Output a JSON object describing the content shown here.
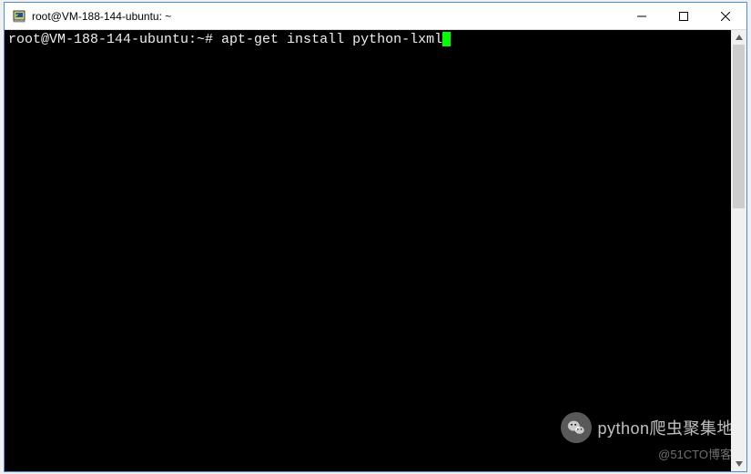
{
  "window": {
    "title": "root@VM-188-144-ubuntu: ~"
  },
  "terminal": {
    "prompt": "root@VM-188-144-ubuntu:~# ",
    "command": "apt-get install python-lxml"
  },
  "watermark": {
    "main": "python爬虫聚集地",
    "sub": "@51CTO博客"
  }
}
